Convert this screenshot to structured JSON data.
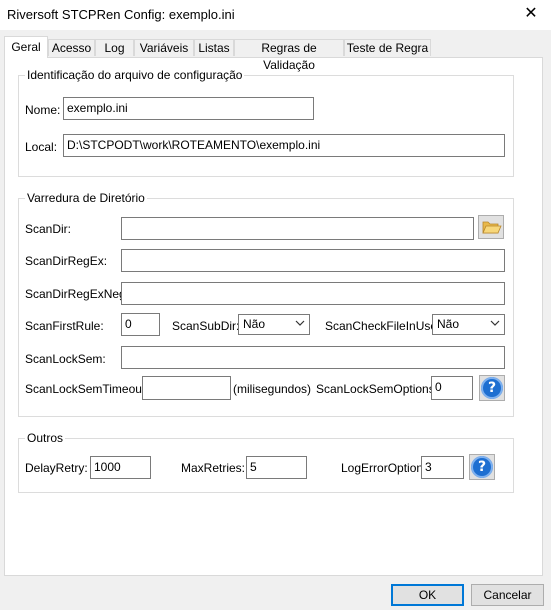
{
  "window": {
    "title": "Riversoft STCPRen Config: exemplo.ini",
    "close_glyph": "✕"
  },
  "tabs": [
    "Geral",
    "Acesso",
    "Log",
    "Variáveis",
    "Listas",
    "Regras de Validação",
    "Teste de Regra"
  ],
  "identificacao": {
    "legend": "Identificação do arquivo de configuração",
    "nome_label": "Nome:",
    "nome_value": "exemplo.ini",
    "local_label": "Local:",
    "local_value": "D:\\STCPODT\\work\\ROTEAMENTO\\exemplo.ini"
  },
  "varredura": {
    "legend": "Varredura de Diretório",
    "scandir_label": "ScanDir:",
    "scandir_value": "",
    "scandirregex_label": "ScanDirRegEx:",
    "scandirregex_value": "",
    "scandirregexneg_label": "ScanDirRegExNeg:",
    "scandirregexneg_value": "",
    "scanfirstrule_label": "ScanFirstRule:",
    "scanfirstrule_value": "0",
    "scansubdir_label": "ScanSubDir:",
    "scansubdir_value": "Não",
    "scancheckfileinuse_label": "ScanCheckFileInUse:",
    "scancheckfileinuse_value": "Não",
    "scanlocksem_label": "ScanLockSem:",
    "scanlocksem_value": "",
    "scanlocksemtimeout_label": "ScanLockSemTimeout:",
    "scanlocksemtimeout_value": "",
    "timeout_unit": "(milisegundos)",
    "scanlocksemoptions_label": "ScanLockSemOptions:",
    "scanlocksemoptions_value": "0",
    "help_glyph": "?"
  },
  "outros": {
    "legend": "Outros",
    "delayretry_label": "DelayRetry:",
    "delayretry_value": "1000",
    "maxretries_label": "MaxRetries:",
    "maxretries_value": "5",
    "logerroroption_label": "LogErrorOption:",
    "logerroroption_value": "3",
    "help_glyph": "?"
  },
  "buttons": {
    "ok": "OK",
    "cancel": "Cancelar"
  },
  "icons": {
    "folder": "folder-open-icon",
    "help": "help-icon",
    "chevron": "chevron-down-icon",
    "close": "close-icon"
  },
  "colors": {
    "accent": "#0078d7",
    "help": "#1e6fd1"
  }
}
